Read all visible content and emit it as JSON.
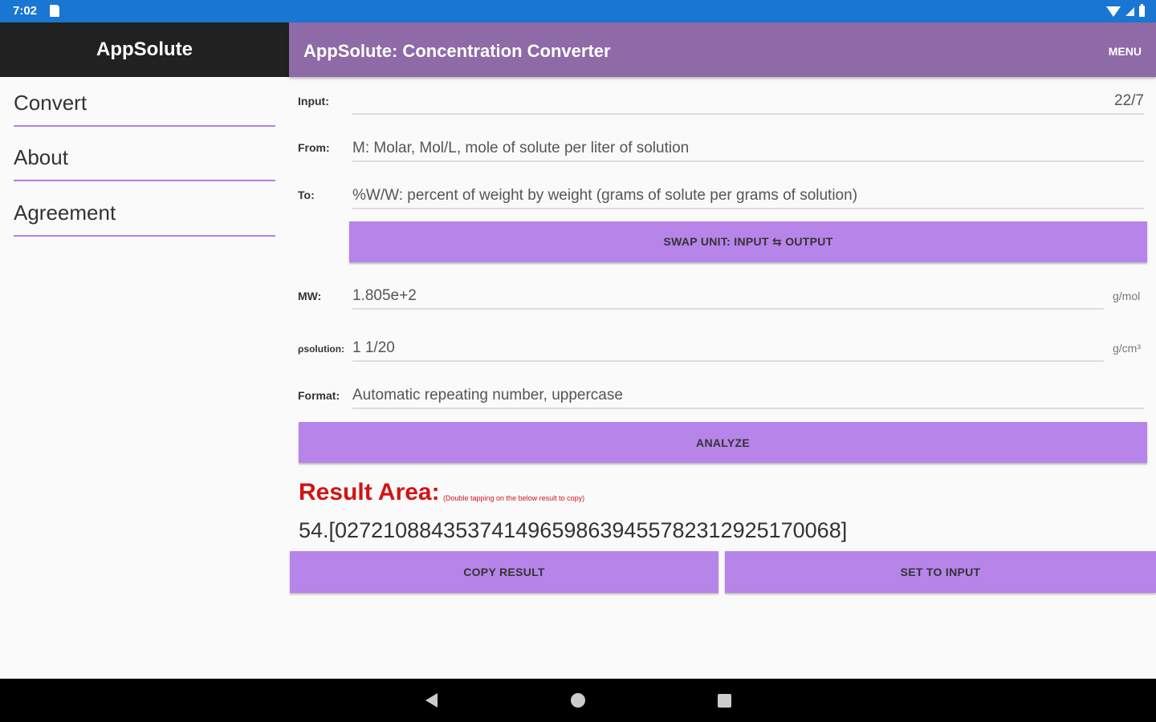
{
  "status_bar": {
    "time": "7:02"
  },
  "sidebar": {
    "title": "AppSolute",
    "items": [
      {
        "label": "Convert"
      },
      {
        "label": "About"
      },
      {
        "label": "Agreement"
      }
    ]
  },
  "header": {
    "title": "AppSolute: Concentration Converter",
    "menu_label": "MENU"
  },
  "form": {
    "input": {
      "label": "Input:",
      "value": "22/7"
    },
    "from": {
      "label": "From:",
      "value": "M: Molar, Mol/L, mole of solute per liter of solution"
    },
    "to": {
      "label": "To:",
      "value": "%W/W: percent of weight by weight (grams of solute per grams of solution)"
    },
    "swap_button": "SWAP UNIT: INPUT ⇆ OUTPUT",
    "mw": {
      "label": "MW:",
      "value": "1.805e+2",
      "unit": "g/mol"
    },
    "density": {
      "label": "ρsolution:",
      "value": "1 1/20",
      "unit": "g/cm³"
    },
    "format": {
      "label": "Format:",
      "value": "Automatic repeating number, uppercase"
    },
    "analyze_button": "ANALYZE"
  },
  "result": {
    "title": "Result Area:",
    "hint": "(Double tapping on the below result to copy)",
    "value": "54.[027210884353741496598639455782312925170068]",
    "copy_button": "COPY RESULT",
    "set_button": "SET TO INPUT"
  },
  "colors": {
    "status_bar": "#1976d2",
    "drawer_header": "#212121",
    "app_bar": "#8e6aa6",
    "button": "#b784ea",
    "accent_underline": "#b57fe9",
    "result_title": "#d21414"
  },
  "icons": [
    "sd-card-icon",
    "wifi-icon",
    "signal-icon",
    "battery-icon",
    "back-icon",
    "home-icon",
    "recents-icon"
  ]
}
